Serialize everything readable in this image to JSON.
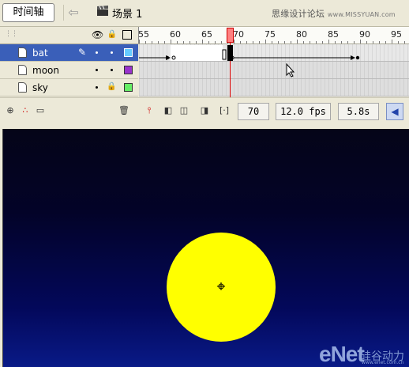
{
  "topbar": {
    "timeline_label": "时间轴",
    "scene_label": "场景 1",
    "watermark": "思缘设计论坛",
    "watermark_url": "www.MISSYUAN.com"
  },
  "ruler": {
    "labels": [
      "55",
      "60",
      "65",
      "70",
      "75",
      "80",
      "85",
      "90",
      "95"
    ],
    "current_frame": 70
  },
  "layers": [
    {
      "name": "bat",
      "selected": true,
      "color": "#66ccff",
      "locked": false
    },
    {
      "name": "moon",
      "selected": false,
      "color": "#9933cc",
      "locked": false
    },
    {
      "name": "sky",
      "selected": false,
      "color": "#66ee66",
      "locked": true
    }
  ],
  "status": {
    "frame": "70",
    "fps": "12.0 fps",
    "time": "5.8s"
  },
  "brand": {
    "enet": "eNet",
    "enet_sub": "硅谷动力",
    "enet_url": "www.enet.com.cn"
  }
}
